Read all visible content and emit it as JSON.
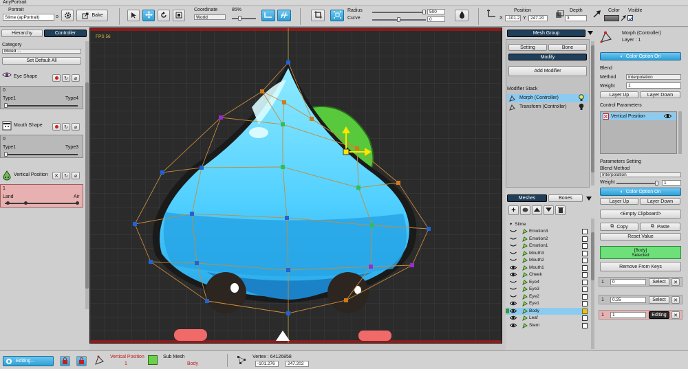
{
  "app": {
    "title": "AnyPortrait"
  },
  "toolbar": {
    "portrait_label": "Portrait",
    "portrait_value": "Slime (apPortrait)",
    "portrait_o": "o",
    "bake_label": "Bake",
    "coordinate_label": "Coordinate",
    "coordinate_value": "World",
    "zoom_value": "85%",
    "radius_label": "Radius",
    "radius_value": "500",
    "curve_label": "Curve",
    "curve_value": "0",
    "position_label": "Position",
    "pos_x_label": "X",
    "pos_x_value": "-101.2",
    "pos_y_label": "Y",
    "pos_y_value": "247.20",
    "depth_label": "Depth",
    "depth_value": "3",
    "color_label": "Color",
    "visible_label": "Visible"
  },
  "left": {
    "tab_hierarchy": "Hierarchy",
    "tab_controller": "Controller",
    "category_label": "Category",
    "category_value": "Mixed ...",
    "set_default": "Set Default All",
    "controllers": [
      {
        "name": "Eye Shape",
        "value": "0",
        "min_label": "Type1",
        "max_label": "Type4",
        "level": 0.0
      },
      {
        "name": "Mouth Shape",
        "value": "0",
        "min_label": "Type1",
        "max_label": "Type3",
        "level": 0.0
      },
      {
        "name": "Vertical Position",
        "value": "1",
        "min_label": "Land",
        "max_label": "Air",
        "level": 1.0
      }
    ]
  },
  "viewport": {
    "fps": "FPS 56"
  },
  "mesh_group": {
    "header": "Mesh Group",
    "tab_setting": "Setting",
    "tab_bone": "Bone",
    "tab_modify": "Modify",
    "add_modifier": "Add Modifier",
    "modifier_stack_label": "Modifier Stack",
    "modifiers": [
      "Morph (Controller)",
      "Transform (Controller)"
    ],
    "meshes_tab": "Meshes",
    "bones_tab": "Bones",
    "root": "Slime",
    "items": [
      "Emotion3",
      "Emotion2",
      "Emotion1",
      "Mouth3",
      "Mouth2",
      "Mouth1",
      "Cheek",
      "Eye4",
      "Eye3",
      "Eye2",
      "Eye1",
      "Body",
      "Leaf",
      "Stem"
    ],
    "selected_item": "Body"
  },
  "right": {
    "title": "Morph (Controller)",
    "subtitle": "Layer : 1",
    "color_option": "Color Option On",
    "blend_label": "Blend",
    "method_label": "Method",
    "method_value": "Interpolation",
    "weight_label": "Weight",
    "weight_value": "1",
    "layer_up": "Layer Up",
    "layer_down": "Layer Down",
    "control_params_label": "Control Parameters",
    "control_param_item": "Vertical Position",
    "params_setting_label": "Parameters Setting",
    "blend_method_label": "Blend Method",
    "blend_method_value": "Interpolation",
    "weight2_label": "Weight",
    "weight2_value": "1",
    "color_option2": "Color Option On",
    "layer_up2": "Layer Up",
    "layer_down2": "Layer Down",
    "clipboard": "<Empty Clipboard>",
    "copy": "Copy",
    "paste": "Paste",
    "reset_value": "Reset Value",
    "selected_line1": "[Body]",
    "selected_line2": "Selected",
    "remove_keys": "Remove From Keys",
    "keys": [
      {
        "index": "1",
        "value": "0",
        "button": "Select"
      },
      {
        "index": "1",
        "value": "0.25",
        "button": "Select"
      },
      {
        "index": "1",
        "value": "1",
        "button": "Editing"
      }
    ]
  },
  "status": {
    "editing": "Editing...",
    "vp_label": "Vertical Position",
    "vp_value": "1",
    "submesh_label": "Sub Mesh",
    "submesh_value": "Body",
    "vertex_label": "Vertex : 64126858",
    "vx": "-101.276",
    "vy": "247.202"
  },
  "colors": {
    "accent": "#35a8e0",
    "selected": "#8ccbf0",
    "keyframe_green": "#6ee07a",
    "editing_red": "#e8b0b0"
  }
}
